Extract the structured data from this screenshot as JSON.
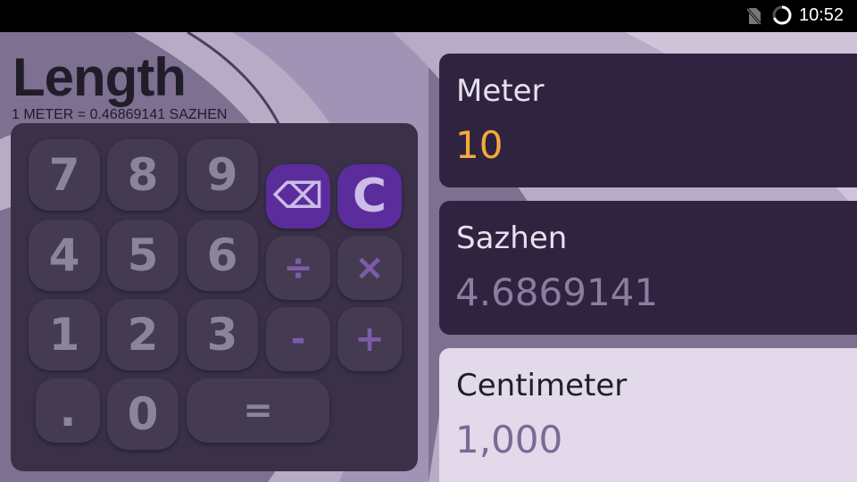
{
  "status_bar": {
    "time": "10:52",
    "icons": [
      "no-sim-icon",
      "loading-spinner-icon"
    ]
  },
  "header": {
    "title": "Length",
    "conversion": "1 METER = 0.46869141 SAZHEN"
  },
  "keypad": {
    "digits": {
      "k7": "7",
      "k8": "8",
      "k9": "9",
      "k4": "4",
      "k5": "5",
      "k6": "6",
      "k1": "1",
      "k2": "2",
      "k3": "3",
      "dot": ".",
      "k0": "0"
    },
    "ops": {
      "backspace": "⌫",
      "clear": "C",
      "divide": "÷",
      "multiply": "×",
      "minus": "-",
      "plus": "+",
      "equals": "="
    }
  },
  "units": [
    {
      "name": "Meter",
      "value": "10"
    },
    {
      "name": "Sazhen",
      "value": "4.6869141"
    },
    {
      "name": "Centimeter",
      "value": "1,000"
    }
  ],
  "colors": {
    "accent": "#5a2c9c",
    "active_value": "#f4a93a",
    "card_dark": "#2f2340",
    "card_light": "#e2d9ea",
    "keypad_bg": "#3a3048"
  }
}
